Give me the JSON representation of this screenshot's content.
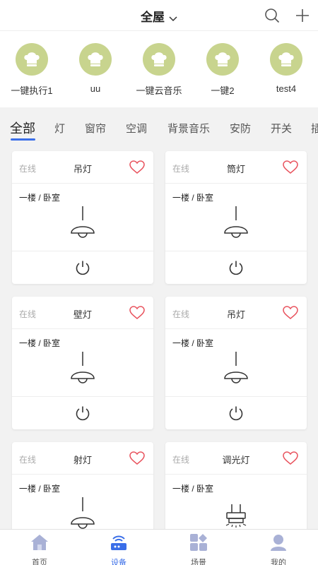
{
  "header": {
    "title": "全屋"
  },
  "scenes": [
    {
      "label": "一键执行1"
    },
    {
      "label": "uu"
    },
    {
      "label": "一键云音乐"
    },
    {
      "label": "一键2"
    },
    {
      "label": "test4"
    }
  ],
  "tabs": [
    "全部",
    "灯",
    "窗帘",
    "空调",
    "背景音乐",
    "安防",
    "开关",
    "插"
  ],
  "devices": [
    {
      "status": "在线",
      "name": "吊灯",
      "location": "一楼 / 卧室",
      "icon": "pendant-lamp-icon"
    },
    {
      "status": "在线",
      "name": "筒灯",
      "location": "一楼 / 卧室",
      "icon": "pendant-lamp-icon"
    },
    {
      "status": "在线",
      "name": "壁灯",
      "location": "一楼 / 卧室",
      "icon": "pendant-lamp-icon"
    },
    {
      "status": "在线",
      "name": "吊灯",
      "location": "一楼 / 卧室",
      "icon": "pendant-lamp-icon"
    },
    {
      "status": "在线",
      "name": "射灯",
      "location": "一楼 / 卧室",
      "icon": "pendant-lamp-icon"
    },
    {
      "status": "在线",
      "name": "调光灯",
      "location": "一楼 / 卧室",
      "icon": "dimmer-lamp-icon"
    }
  ],
  "nav": [
    {
      "label": "首页",
      "icon": "home-icon"
    },
    {
      "label": "设备",
      "icon": "device-icon"
    },
    {
      "label": "场景",
      "icon": "scene-icon"
    },
    {
      "label": "我的",
      "icon": "profile-icon"
    }
  ],
  "colors": {
    "accent": "#3a6ee8",
    "scene_circle": "#c8d48e",
    "heart": "#e8505b"
  }
}
